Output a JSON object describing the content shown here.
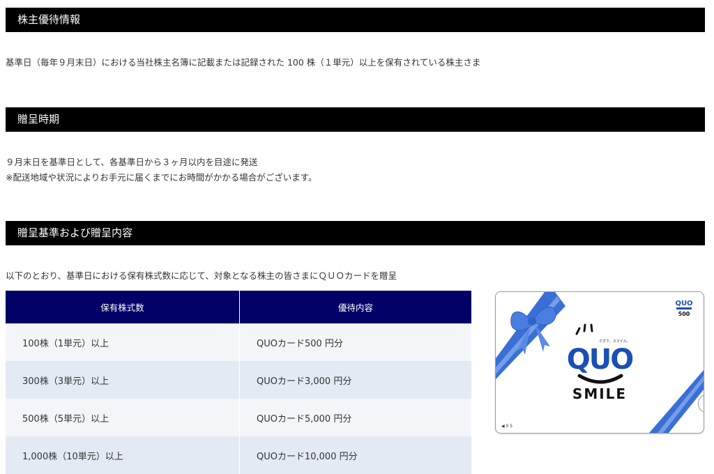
{
  "sections": {
    "benefit_info": {
      "title": "株主優待情報",
      "text": "基準日（毎年９月末日）における当社株主名簿に記載または記録された 100 株（１単元）以上を保有されている株主さま"
    },
    "timing": {
      "title": "贈呈時期",
      "line1": "９月末日を基準日として、各基準日から３ヶ月以内を目途に発送",
      "line2": "※配送地域や状況によりお手元に届くまでにお時間がかかる場合がございます。"
    },
    "criteria": {
      "title": "贈呈基準および贈呈内容",
      "text": "以下のとおり、基準日における保有株式数に応じて、対象となる株主の皆さまにＱＵＯカードを贈呈"
    }
  },
  "table": {
    "headers": [
      "保有株式数",
      "優待内容"
    ],
    "rows": [
      {
        "shares": "100株（1単元）以上",
        "benefit": "QUOカード500 円分"
      },
      {
        "shares": "300株（3単元）以上",
        "benefit": "QUOカード3,000 円分"
      },
      {
        "shares": "500株（5単元）以上",
        "benefit": "QUOカード5,000 円分"
      },
      {
        "shares": "1,000株（10単元）以上",
        "benefit": "QUOカード10,000 円分"
      }
    ]
  },
  "card": {
    "logo": "QUO",
    "smile": "SMILE",
    "tagline": "クオで、スマイル。",
    "corner_logo": "QUO",
    "corner_value": "500",
    "bottom_marks": "◀  0  5",
    "colors": {
      "brand": "#1a4fb4",
      "ribbon": "#3a6fd6",
      "ribbon_light": "#7fa8ee",
      "header": "#000066"
    }
  }
}
